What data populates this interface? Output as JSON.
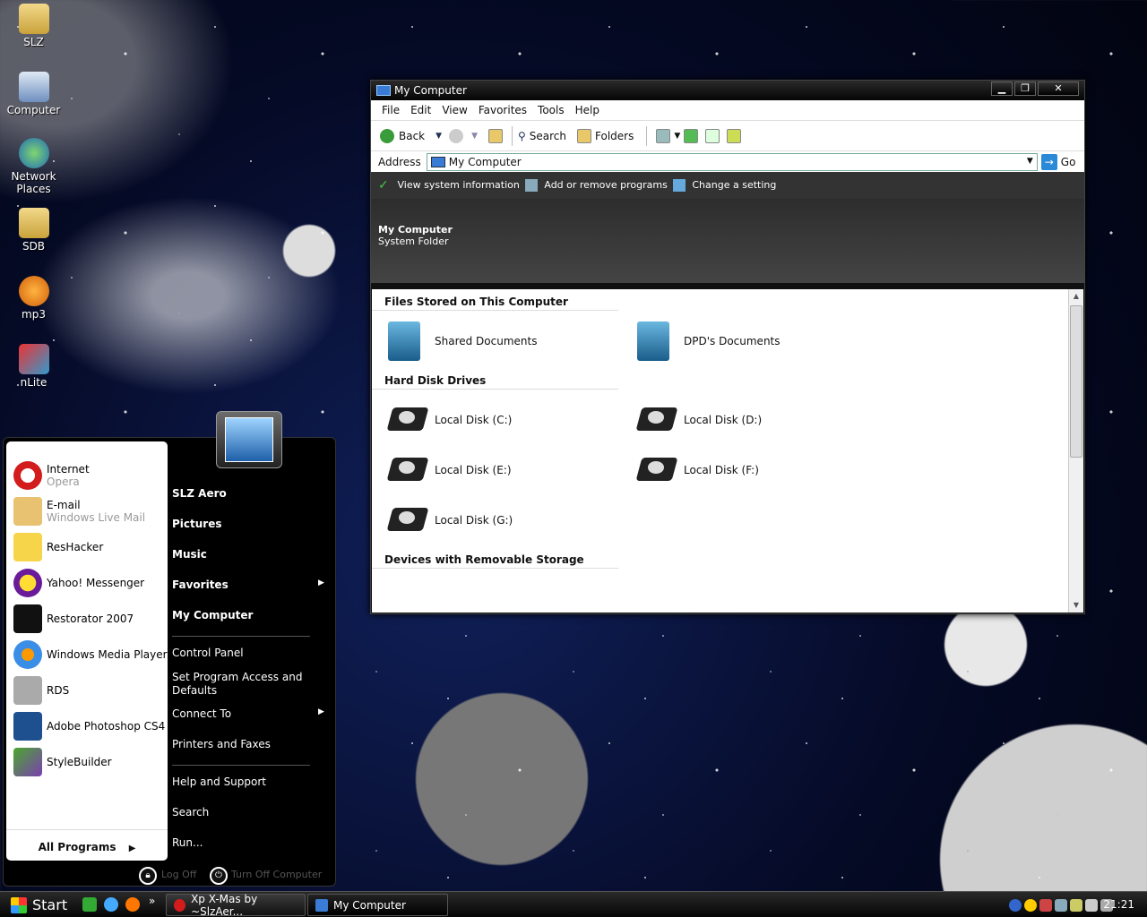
{
  "desktop": {
    "icons": [
      {
        "label": "SLZ"
      },
      {
        "label": "Computer"
      },
      {
        "label": "Network Places"
      },
      {
        "label": "SDB"
      },
      {
        "label": "mp3"
      },
      {
        "label": "nLite"
      }
    ]
  },
  "window": {
    "title": "My Computer",
    "buttons": {
      "minimize": "▁",
      "restore": "❐",
      "close": "✕"
    },
    "menu": [
      "File",
      "Edit",
      "View",
      "Favorites",
      "Tools",
      "Help"
    ],
    "toolbar": {
      "back": "Back",
      "search": "Search",
      "folders": "Folders"
    },
    "address": {
      "label": "Address",
      "value": "My Computer",
      "go": "Go"
    },
    "tasks": [
      "View system information",
      "Add or remove programs",
      "Change a setting"
    ],
    "info": {
      "title": "My Computer",
      "subtitle": "System Folder"
    },
    "groups": {
      "files": "Files Stored on This Computer",
      "disks": "Hard Disk Drives",
      "removable": "Devices with Removable Storage"
    },
    "files": [
      "Shared Documents",
      "DPD's Documents"
    ],
    "disks": [
      "Local Disk (C:)",
      "Local Disk (D:)",
      "Local Disk (E:)",
      "Local Disk (F:)",
      "Local Disk (G:)"
    ]
  },
  "startmenu": {
    "pinned": [
      {
        "title": "Internet",
        "sub": "Opera",
        "color": "#d31c1c"
      },
      {
        "title": "E-mail",
        "sub": "Windows Live Mail",
        "color": "#e8c270"
      },
      {
        "title": "ResHacker",
        "sub": "",
        "color": "#333333"
      },
      {
        "title": "Yahoo! Messenger",
        "sub": "",
        "color": "#6a1b9a"
      },
      {
        "title": "Restorator 2007",
        "sub": "",
        "color": "#111111"
      },
      {
        "title": "Windows Media Player",
        "sub": "",
        "color": "#3a8ee6"
      },
      {
        "title": "RDS",
        "sub": "",
        "color": "#777777"
      },
      {
        "title": "Adobe Photoshop CS4",
        "sub": "",
        "color": "#1e4f8f"
      },
      {
        "title": "StyleBuilder",
        "sub": "",
        "color": "#4aa82e"
      }
    ],
    "all_programs": "All Programs",
    "right": {
      "slz": "SLZ Aero",
      "pictures": "Pictures",
      "music": "Music",
      "favorites": "Favorites",
      "mycomputer": "My Computer",
      "control": "Control Panel",
      "spad": "Set Program Access and Defaults",
      "connect": "Connect To",
      "printers": "Printers and Faxes",
      "help": "Help and Support",
      "search": "Search",
      "run": "Run..."
    },
    "logoff": "Log Off",
    "turnoff": "Turn Off Computer"
  },
  "taskbar": {
    "start": "Start",
    "more": "»",
    "items": [
      "Xp X-Mas by ~SlzAer...",
      "My Computer"
    ],
    "clock": "21:21"
  }
}
